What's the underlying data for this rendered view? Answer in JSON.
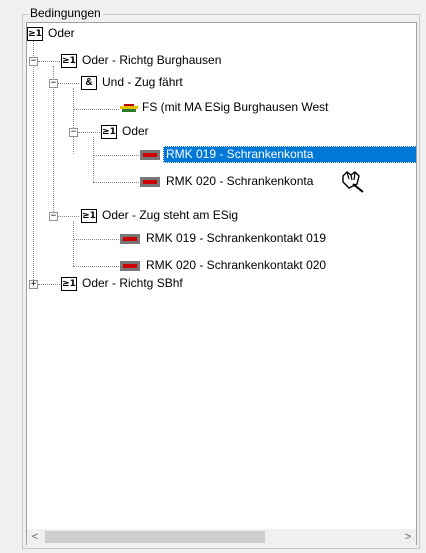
{
  "groupbox": {
    "title": "Bedingungen"
  },
  "tree": {
    "nodes": [
      {
        "label": "Oder",
        "icon": "or-gate-icon",
        "symbol": "≥1"
      },
      {
        "label": "Oder - Richtg Burghausen",
        "icon": "or-gate-icon",
        "symbol": "≥1",
        "expander": "−"
      },
      {
        "label": "Und - Zug fährt",
        "icon": "and-gate-icon",
        "symbol": "&",
        "expander": "−"
      },
      {
        "label": "FS (mit MA ESig Burghausen West",
        "icon": "route-signal-icon"
      },
      {
        "label": "Oder",
        "icon": "or-gate-icon",
        "symbol": "≥1",
        "expander": "−"
      },
      {
        "label": "RMK 019 - Schrankenkonta",
        "icon": "track-contact-icon",
        "selected": true
      },
      {
        "label": "RMK 020 - Schrankenkonta",
        "icon": "track-contact-icon"
      },
      {
        "label": "Oder - Zug steht am ESig",
        "icon": "or-gate-icon",
        "symbol": "≥1",
        "expander": "−"
      },
      {
        "label": "RMK 019 - Schrankenkontakt 019",
        "icon": "track-contact-icon"
      },
      {
        "label": "RMK 020 - Schrankenkontakt 020",
        "icon": "track-contact-icon"
      },
      {
        "label": "Oder - Richtg SBhf",
        "icon": "or-gate-icon",
        "symbol": "≥1",
        "expander": "+"
      }
    ]
  },
  "scrollbar": {
    "left_arrow": "<",
    "right_arrow": ">"
  },
  "colors": {
    "selection": "#0078d7",
    "contact_red": "#d00000",
    "contact_gray": "#777777"
  }
}
